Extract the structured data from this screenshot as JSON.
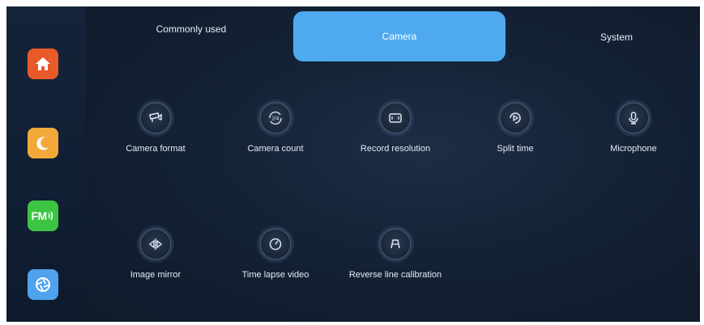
{
  "sidebar": {
    "apps": [
      {
        "name": "home",
        "icon": "home-icon",
        "color": "#e85a2a"
      },
      {
        "name": "night-mode",
        "icon": "moon-icon",
        "color": "#f2a93a"
      },
      {
        "name": "fm-radio",
        "icon": "fm-icon",
        "label": "FM",
        "color": "#3cc443"
      },
      {
        "name": "camera",
        "icon": "aperture-icon",
        "color": "#4ea2ee"
      }
    ]
  },
  "tabs": [
    {
      "label": "Commonly used",
      "active": false
    },
    {
      "label": "Camera",
      "active": true
    },
    {
      "label": "System",
      "active": false
    }
  ],
  "accent_color": "#4fa9ef",
  "settings": {
    "items": [
      {
        "label": "Camera format",
        "icon": "camera-format-icon"
      },
      {
        "label": "Camera count",
        "icon": "camera-count-icon",
        "icon_text": "2/4"
      },
      {
        "label": "Record resolution",
        "icon": "record-resolution-icon"
      },
      {
        "label": "Split time",
        "icon": "split-time-icon"
      },
      {
        "label": "Microphone",
        "icon": "microphone-icon"
      },
      {
        "label": "Image mirror",
        "icon": "image-mirror-icon"
      },
      {
        "label": "Time lapse video",
        "icon": "time-lapse-icon"
      },
      {
        "label": "Reverse line calibration",
        "icon": "reverse-line-icon"
      }
    ]
  }
}
